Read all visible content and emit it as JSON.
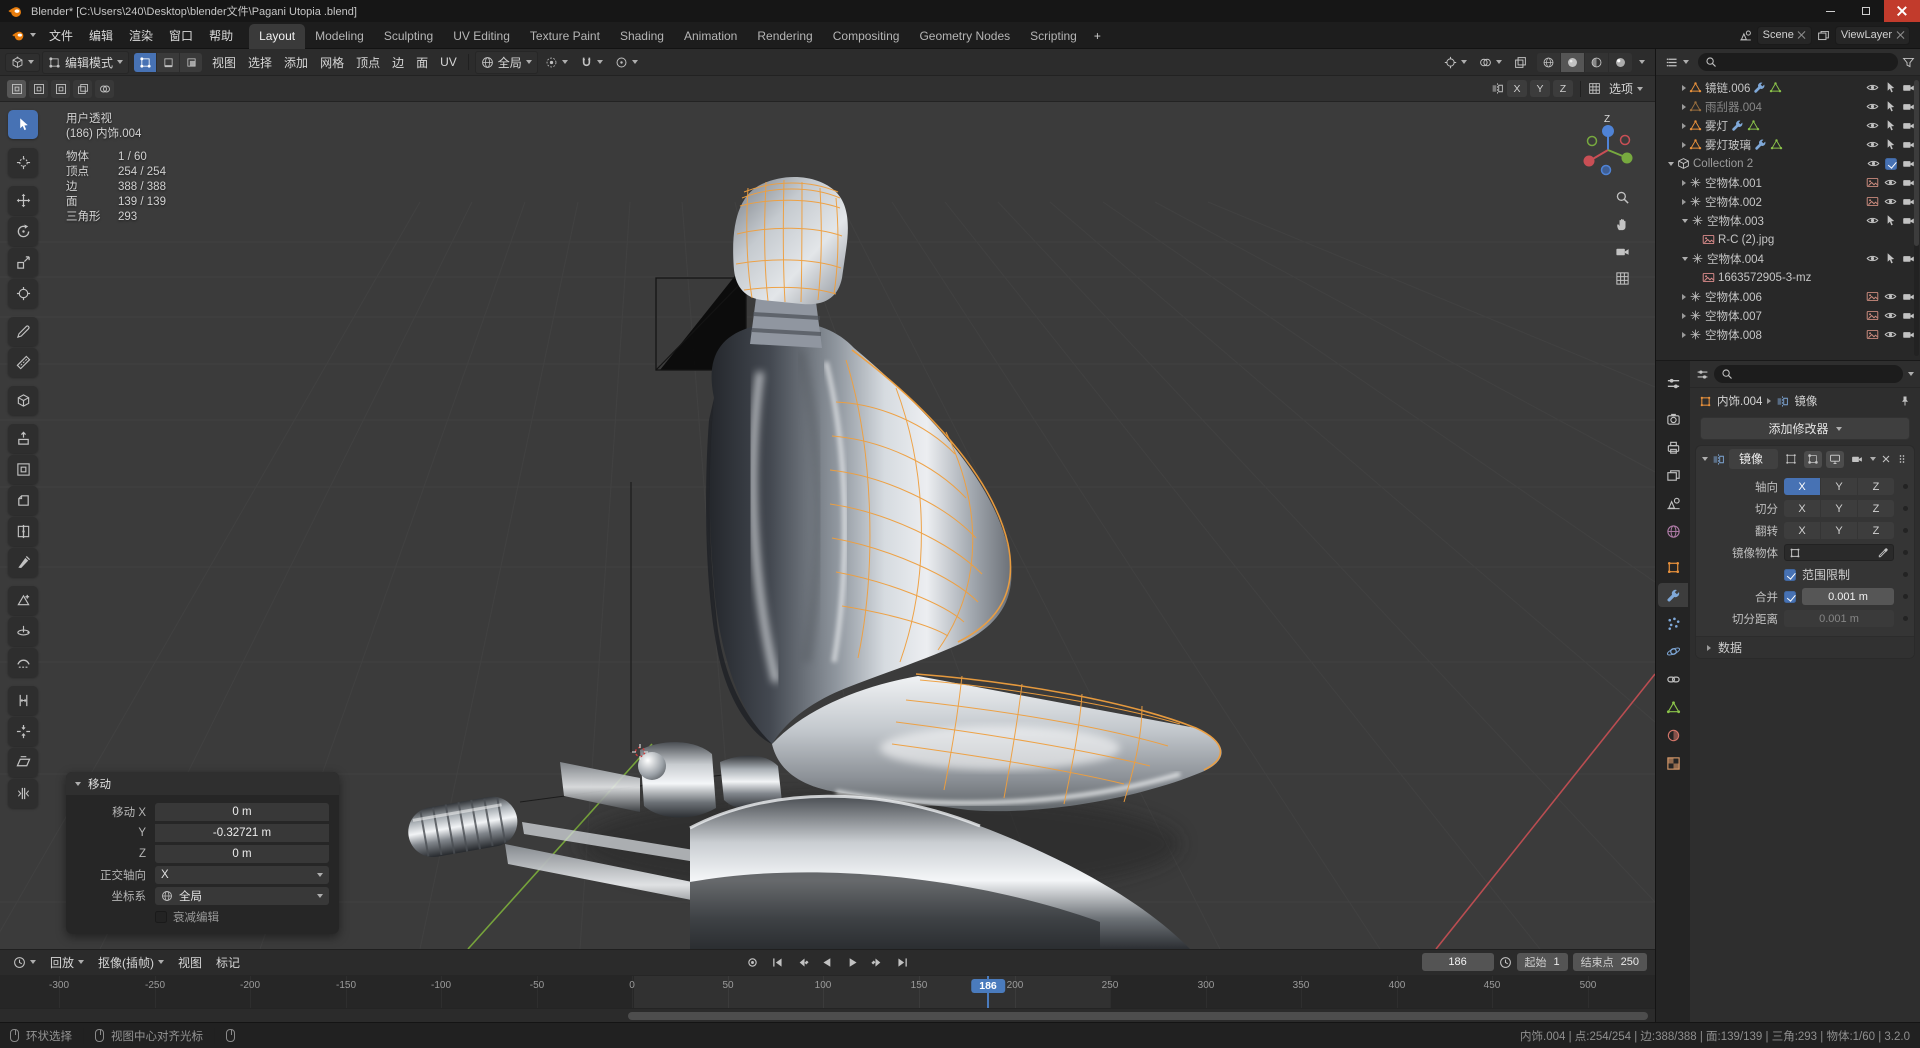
{
  "titlebar": {
    "title": "Blender* [C:\\Users\\240\\Desktop\\blender文件\\Pagani Utopia .blend]"
  },
  "topbar": {
    "menus": [
      "文件",
      "编辑",
      "渲染",
      "窗口",
      "帮助"
    ],
    "workspaces": [
      "Layout",
      "Modeling",
      "Sculpting",
      "UV Editing",
      "Texture Paint",
      "Shading",
      "Animation",
      "Rendering",
      "Compositing",
      "Geometry Nodes",
      "Scripting"
    ],
    "add_tab": "+",
    "scene": "Scene",
    "viewlayer": "ViewLayer"
  },
  "viewport_header": {
    "mode": "编辑模式",
    "menus": [
      "视图",
      "选择",
      "添加",
      "网格",
      "顶点",
      "边",
      "面",
      "UV"
    ],
    "orientation": "全局"
  },
  "tool_options": {
    "axes": [
      "X",
      "Y",
      "Z"
    ],
    "options": "选项"
  },
  "viewport": {
    "view_label": "用户透视",
    "object_label": "(186) 内饰.004",
    "stats": [
      {
        "label": "物体",
        "value": "1 / 60"
      },
      {
        "label": "顶点",
        "value": "254 / 254"
      },
      {
        "label": "边",
        "value": "388 / 388"
      },
      {
        "label": "面",
        "value": "139 / 139"
      },
      {
        "label": "三角形",
        "value": "293"
      }
    ],
    "gizmo_axis": "Z"
  },
  "move_panel": {
    "title": "移动",
    "rows": [
      {
        "label": "移动 X",
        "value": "0 m"
      },
      {
        "label": "Y",
        "value": "-0.32721 m"
      },
      {
        "label": "Z",
        "value": "0 m"
      }
    ],
    "axis_label": "正交轴向",
    "axis_value": "X",
    "orient_label": "坐标系",
    "orient_value": "全局",
    "falloff_label": "衰减编辑"
  },
  "timeline": {
    "menus": [
      "回放",
      "抠像(插帧)",
      "视图",
      "标记"
    ],
    "frame": "186",
    "start_label": "起始",
    "start": "1",
    "end_label": "结束点",
    "end": "250",
    "ticks": [
      "-300",
      "-250",
      "-200",
      "-150",
      "-100",
      "-50",
      "0",
      "50",
      "100",
      "150",
      "200",
      "250",
      "300",
      "350",
      "400",
      "450",
      "500"
    ]
  },
  "statusbar": {
    "items": [
      "环状选择",
      "视图中心对齐光标"
    ],
    "right": "内饰.004 | 点:254/254 | 边:388/388 | 面:139/139 | 三角:293 | 物体:1/60 | 3.2.0"
  },
  "outliner": {
    "rows": [
      {
        "name": "镜链.006"
      },
      {
        "name": "雨刮器.004"
      },
      {
        "name": "雾灯"
      },
      {
        "name": "雾灯玻璃"
      },
      {
        "name": "Collection 2"
      },
      {
        "name": "空物体.001"
      },
      {
        "name": "空物体.002"
      },
      {
        "name": "空物体.003"
      },
      {
        "name": "R-C (2).jpg"
      },
      {
        "name": "空物体.004"
      },
      {
        "name": "1663572905-3-mz"
      },
      {
        "name": "空物体.006"
      },
      {
        "name": "空物体.007"
      },
      {
        "name": "空物体.008"
      }
    ]
  },
  "properties": {
    "breadcrumb_object": "内饰.004",
    "breadcrumb_modifier": "镜像",
    "add_modifier": "添加修改器",
    "modifier": {
      "name": "镜像",
      "axis_label": "轴向",
      "bisect_label": "切分",
      "flip_label": "翻转",
      "axes": [
        "X",
        "Y",
        "Z"
      ],
      "mirror_object_label": "镜像物体",
      "clipping_label": "范围限制",
      "merge_label": "合并",
      "merge_value": "0.001 m",
      "bisect_dist_label": "切分距离",
      "bisect_dist_value": "0.001 m",
      "data_label": "数据"
    }
  }
}
